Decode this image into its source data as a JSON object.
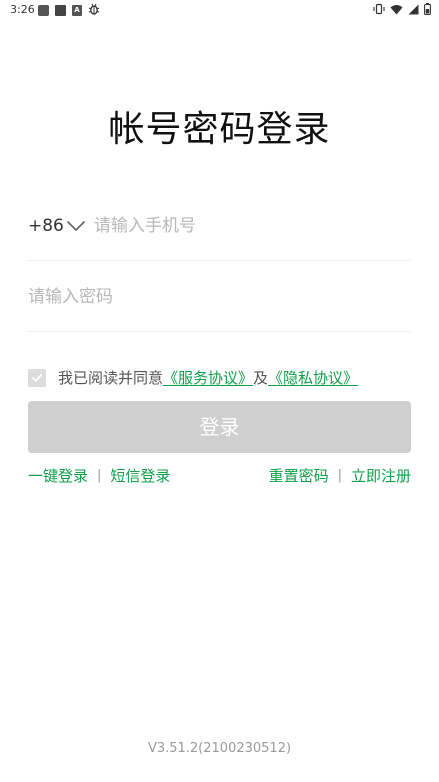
{
  "status_bar": {
    "time": "3:26",
    "left_icons": [
      "app-icon",
      "app-icon",
      "a-icon",
      "bug-icon"
    ],
    "right_icons": [
      "vibrate-icon",
      "wifi-icon",
      "signal-icon",
      "battery-icon"
    ]
  },
  "title": "帐号密码登录",
  "phone": {
    "country_code": "+86",
    "placeholder": "请输入手机号",
    "value": ""
  },
  "password": {
    "placeholder": "请输入密码",
    "value": ""
  },
  "agreement": {
    "checked": true,
    "prefix": "我已阅读并同意",
    "service_link": "《服务协议》",
    "connector": "及",
    "privacy_link": "《隐私协议》"
  },
  "login_button": {
    "label": "登录"
  },
  "links": {
    "one_click": "一键登录",
    "sms": "短信登录",
    "reset_password": "重置密码",
    "register": "立即注册",
    "separator": "|"
  },
  "version": "V3.51.2(2100230512)",
  "colors": {
    "accent_green": "#0fa04a",
    "button_disabled": "#cfcfcf",
    "placeholder": "#b8b8b8",
    "divider": "#eeeeee"
  }
}
